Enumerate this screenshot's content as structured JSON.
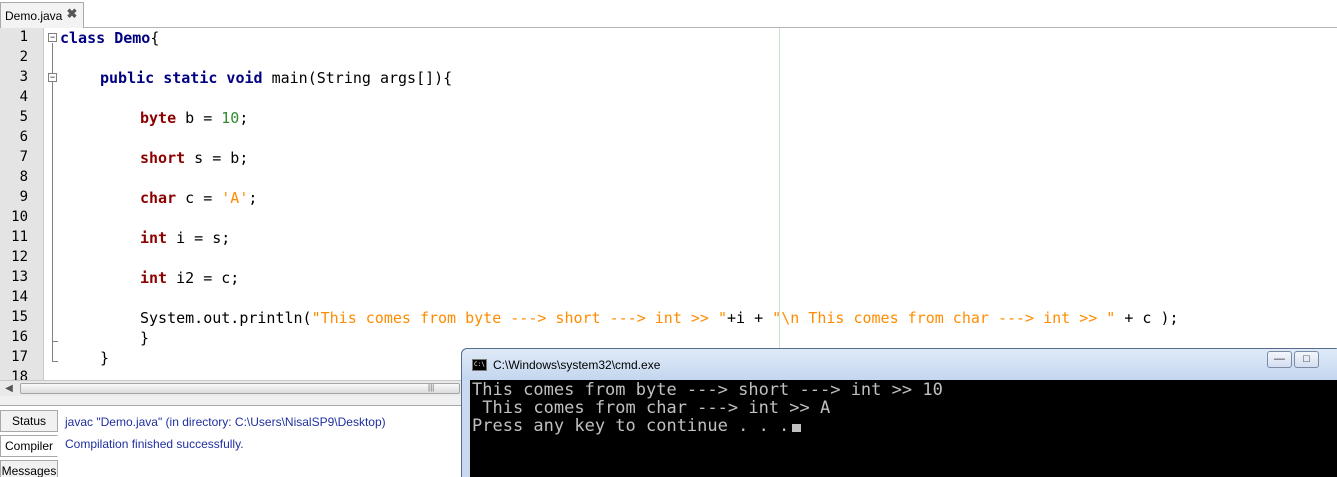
{
  "tab": {
    "label": "Demo.java",
    "close": "✖"
  },
  "editor": {
    "line_numbers": [
      "1",
      "2",
      "3",
      "4",
      "5",
      "6",
      "7",
      "8",
      "9",
      "10",
      "11",
      "12",
      "13",
      "14",
      "15",
      "16",
      "17",
      "18"
    ],
    "code": {
      "l1_kw": "class",
      "l1_name": "Demo",
      "l1_rest": "{",
      "l3_kw": "public static void",
      "l3_rest": " main(String args[]){",
      "l5_type": "byte",
      "l5_mid": " b = ",
      "l5_num": "10",
      "l5_end": ";",
      "l7_type": "short",
      "l7_rest": " s = b;",
      "l9_type": "char",
      "l9_mid": " c = ",
      "l9_str": "'A'",
      "l9_end": ";",
      "l11_type": "int",
      "l11_rest": " i = s;",
      "l13_type": "int",
      "l13_rest": " i2 = c;",
      "l15_a": "System.out.println(",
      "l15_s1": "\"This comes from byte ---> short ---> int >> \"",
      "l15_b": "+i + ",
      "l15_s2": "\"\\n This comes from char ---> int >> \"",
      "l15_c": " + c );",
      "l16": "}",
      "l17": "}"
    }
  },
  "scrollbar": {
    "left_arrow": "◀",
    "grip": "|||"
  },
  "output": {
    "tabs": [
      "Status",
      "Compiler",
      "Messages"
    ],
    "lines": [
      "javac \"Demo.java\" (in directory: C:\\Users\\NisalSP9\\Desktop)",
      "Compilation finished successfully."
    ]
  },
  "cmd": {
    "title": "C:\\Windows\\system32\\cmd.exe",
    "icon_text": "C:\\",
    "buttons": {
      "minimize": "—",
      "maximize": "□"
    },
    "lines": [
      "This comes from byte ---> short ---> int >> 10",
      " This comes from char ---> int >> A",
      "Press any key to continue . . ."
    ]
  },
  "colors": {
    "keyword": "#000080",
    "type": "#8b0000",
    "number": "#2e8b2e",
    "string": "#ff8c00",
    "console_bg": "#000000",
    "console_text": "#c0c0c0"
  }
}
